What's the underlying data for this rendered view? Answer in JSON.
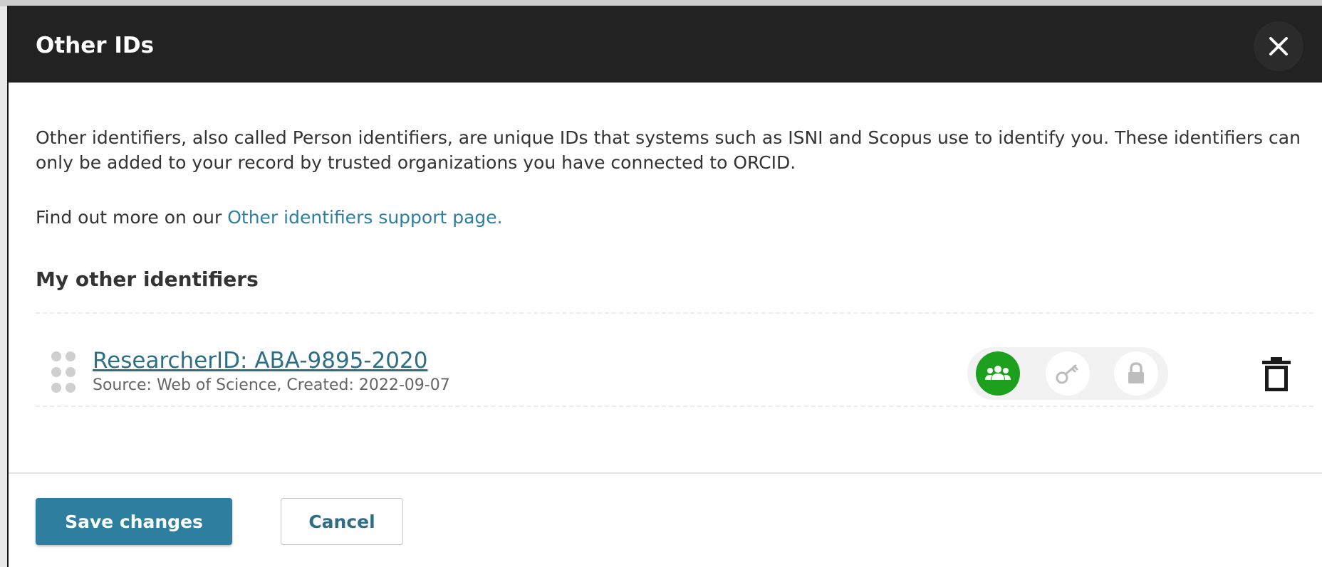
{
  "modal": {
    "title": "Other IDs",
    "close_icon": "close-icon"
  },
  "intro": {
    "paragraph": "Other identifiers, also called Person identifiers, are unique IDs that systems such as ISNI and Scopus use to identify you. These identifiers can only be added to your record by trusted organizations you have connected to ORCID.",
    "find_out_prefix": "Find out more on our ",
    "support_link": "Other identifiers support page."
  },
  "section": {
    "heading": "My other identifiers"
  },
  "identifiers": [
    {
      "label": "ResearcherID: ABA-9895-2020",
      "source": "Source: Web of Science, Created: 2022-09-07",
      "visibility_selected": "everyone",
      "icons": {
        "drag": "drag-handle-icon",
        "everyone": "people-group-icon",
        "trusted": "key-icon",
        "private": "lock-icon",
        "delete": "trash-icon"
      }
    }
  ],
  "colors": {
    "header_bg": "#222222",
    "accent": "#2e7f9f",
    "visibility_active": "#1da01d"
  },
  "footer": {
    "save_label": "Save changes",
    "cancel_label": "Cancel"
  }
}
